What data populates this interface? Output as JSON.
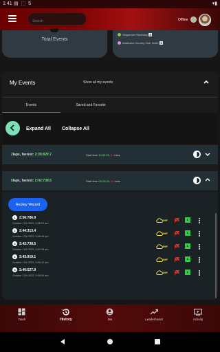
{
  "status_bar": {
    "time": "1:41",
    "icons": "▤ ⬚ 5"
  },
  "app_bar": {
    "search_placeholder": "Search",
    "status_text": "Offline"
  },
  "cards": {
    "left_label": "Total Events",
    "right_items": [
      {
        "name": "Singamian Raceway",
        "count": "4",
        "dot_color": "#8bc34a"
      },
      {
        "name": "Autobahn Country Club North",
        "count": "3",
        "dot_color": "#ce93d8"
      }
    ]
  },
  "events": {
    "title": "My Events",
    "show_all": "Show all my events",
    "tabs": [
      "Events",
      "Saved and Favorite"
    ],
    "expand_all": "Expand All",
    "collapse_all": "Collapse All",
    "rows": [
      {
        "laps": "2",
        "fastest_label": "laps, fastest: ",
        "fastest": "2:39:829.7",
        "start_label": "Start time ",
        "start_time": "10:59:59",
        "sep": ", ",
        "mins": "11",
        "mins_label": " mins"
      },
      {
        "laps": "5",
        "fastest_label": "laps, fastest: ",
        "fastest": "2:42:738.5",
        "start_label": "Start time ",
        "start_time": "09:39:26",
        "sep": ", ",
        "mins": "21",
        "mins_label": " mins"
      }
    ],
    "replay_label": "Replay Wizard",
    "laps": [
      {
        "num": "1",
        "time": "2:56:786.9",
        "date": "October 17th 2022, 9:36:21 am",
        "temp": "59F"
      },
      {
        "num": "2",
        "time": "2:44:313.4",
        "date": "October 17th 2022, 9:46:46 am",
        "temp": "59F"
      },
      {
        "num": "3",
        "time": "2:42:738.5",
        "date": "October 17th 2022, 9:51:28 am",
        "temp": "59F"
      },
      {
        "num": "4",
        "time": "2:43:919.1",
        "date": "October 17th 2022, 9:54:12 am",
        "temp": "59F"
      },
      {
        "num": "5",
        "time": "2:46:527.9",
        "date": "October 17th 2022, 9:56:59 am",
        "temp": "59F"
      }
    ],
    "lap_badge": "L"
  },
  "bottom_nav": [
    {
      "label": "Dash",
      "icon": "dashboard-icon"
    },
    {
      "label": "History",
      "icon": "history-icon",
      "active": true
    },
    {
      "label": "Me",
      "icon": "account-icon"
    },
    {
      "label": "Leaderboard",
      "icon": "trending-icon"
    },
    {
      "label": "Activity",
      "icon": "activity-icon"
    }
  ],
  "colors": {
    "accent_red": "#7e0303",
    "green": "#7be07b",
    "red": "#ef5350",
    "blue": "#1a62f0",
    "fab": "#7de0b7"
  }
}
